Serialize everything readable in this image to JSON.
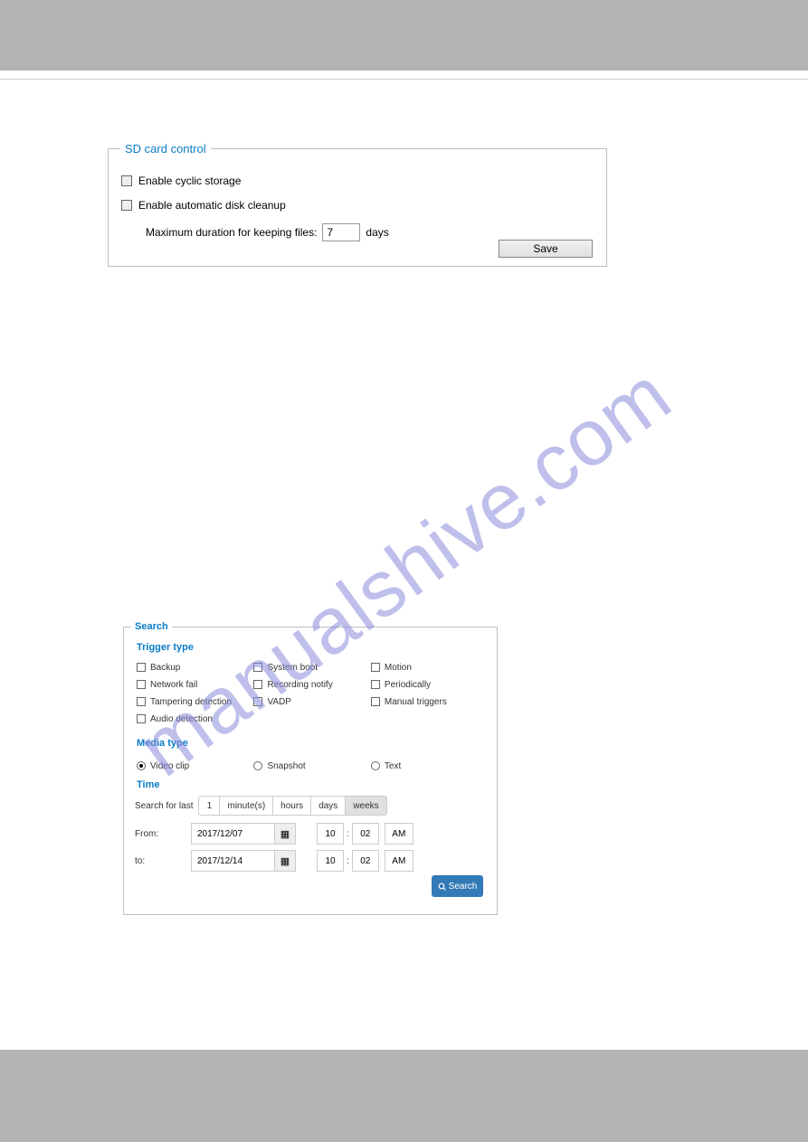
{
  "watermark": "manualshive.com",
  "sd": {
    "legend": "SD card control",
    "enable_cyclic": "Enable cyclic storage",
    "enable_cleanup": "Enable automatic disk cleanup",
    "max_dur_label": "Maximum duration for keeping files:",
    "days_value": "7",
    "days_unit": "days",
    "save": "Save"
  },
  "search": {
    "legend": "Search",
    "trigger_heading": "Trigger type",
    "triggers": [
      {
        "label": "Backup"
      },
      {
        "label": "System boot"
      },
      {
        "label": "Motion"
      },
      {
        "label": "Network fail"
      },
      {
        "label": "Recording notify"
      },
      {
        "label": "Periodically"
      },
      {
        "label": "Tampering detection"
      },
      {
        "label": "VADP"
      },
      {
        "label": "Manual triggers"
      },
      {
        "label": "Audio detection"
      }
    ],
    "media_heading": "Media type",
    "media": [
      {
        "label": "Video clip",
        "selected": true
      },
      {
        "label": "Snapshot",
        "selected": false
      },
      {
        "label": "Text",
        "selected": false
      }
    ],
    "time_heading": "Time",
    "search_for_last": "Search for last",
    "last_value": "1",
    "units": [
      "minute(s)",
      "hours",
      "days",
      "weeks"
    ],
    "selected_unit": "weeks",
    "from_label": "From:",
    "to_label": "to:",
    "from_date": "2017/12/07",
    "to_date": "2017/12/14",
    "from_hour": "10",
    "from_min": "02",
    "from_ampm": "AM",
    "to_hour": "10",
    "to_min": "02",
    "to_ampm": "AM",
    "search_btn": "Search"
  }
}
